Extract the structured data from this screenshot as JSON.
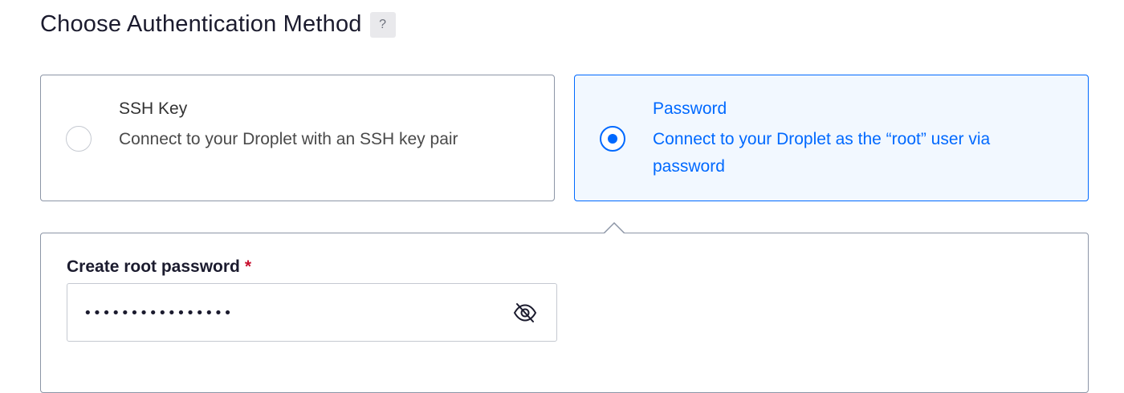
{
  "section": {
    "title": "Choose Authentication Method",
    "help_label": "?"
  },
  "options": [
    {
      "id": "ssh-key",
      "title": "SSH Key",
      "description": "Connect to your Droplet with an SSH key pair",
      "selected": false
    },
    {
      "id": "password",
      "title": "Password",
      "description": "Connect to your Droplet as the “root” user via password",
      "selected": true
    }
  ],
  "password_panel": {
    "label": "Create root password",
    "required_marker": "*",
    "value_masked": "••••••••••••••••",
    "visibility_icon": "eye-slash-icon"
  },
  "colors": {
    "accent": "#0069ff",
    "selected_background": "#f2f8ff",
    "required": "#c8102e"
  }
}
